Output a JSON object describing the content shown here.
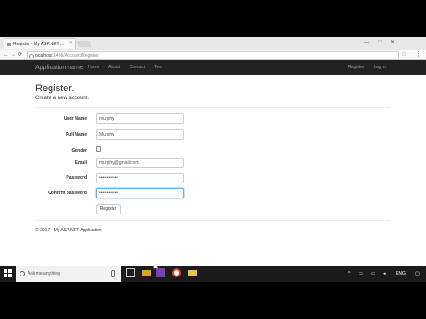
{
  "browser": {
    "tab_title": "Register - My ASP.NET ...",
    "tab_close": "×",
    "url_host": "localhost",
    "url_path": ":1406/Account/Register",
    "win_min": "—",
    "win_max": "□",
    "win_close": "✕",
    "back": "←",
    "forward": "→",
    "reload": "⟳",
    "star": "☆",
    "menu": "⋮"
  },
  "navbar": {
    "brand": "Application name",
    "links": [
      "Home",
      "About",
      "Contact",
      "Test"
    ],
    "right_links": [
      "Register",
      "Log in"
    ]
  },
  "page": {
    "title": "Register.",
    "subtitle": "Create a new account."
  },
  "form": {
    "user_name_label": "User Name",
    "user_name_value": "murphy",
    "full_name_label": "Full Name",
    "full_name_value": "Murphy",
    "gender_label": "Gender",
    "email_label": "Email",
    "email_value": "murphy@gmail.com",
    "password_label": "Password",
    "password_value": "••••••••••••",
    "confirm_label": "Confirm password",
    "confirm_value": "••••••••••••",
    "register_button": "Register"
  },
  "footer": {
    "text": "© 2017 - My ASP.NET Application"
  },
  "taskbar": {
    "search_placeholder": "Ask me anything",
    "lang": "ENG"
  }
}
